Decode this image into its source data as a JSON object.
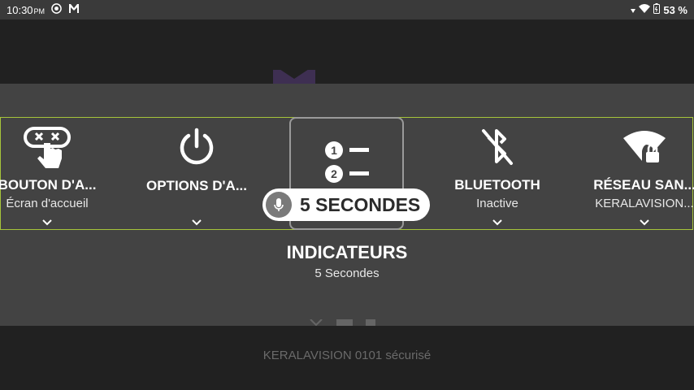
{
  "status_bar": {
    "time": "10:30",
    "ampm": "PM",
    "battery": "53 %",
    "icons": [
      "chrome-icon",
      "app-logo-icon",
      "signal-icon",
      "wifi-icon",
      "battery-icon"
    ]
  },
  "background": {
    "ssid_text": "KERALAVISION 0101 sécurisé"
  },
  "menu": {
    "items": [
      {
        "title": "BOUTON D'A...",
        "subtitle": "Écran d'accueil",
        "icon": "touch-gesture-icon"
      },
      {
        "title": "OPTIONS D'A...",
        "subtitle": "",
        "icon": "power-icon"
      },
      {
        "title": "",
        "subtitle": "",
        "icon": "numbered-list-icon"
      },
      {
        "title": "BLUETOOTH",
        "subtitle": "Inactive",
        "icon": "bluetooth-off-icon"
      },
      {
        "title": "RÉSEAU SAN...",
        "subtitle": "KERALAVISION...",
        "icon": "wifi-lock-icon"
      }
    ],
    "voice_pill": "5 SECONDES"
  },
  "caption": {
    "title": "INDICATEURS",
    "subtitle": "5 Secondes"
  },
  "colors": {
    "focus_border": "#a6c53a",
    "panel": "#434343",
    "background": "#212121"
  }
}
